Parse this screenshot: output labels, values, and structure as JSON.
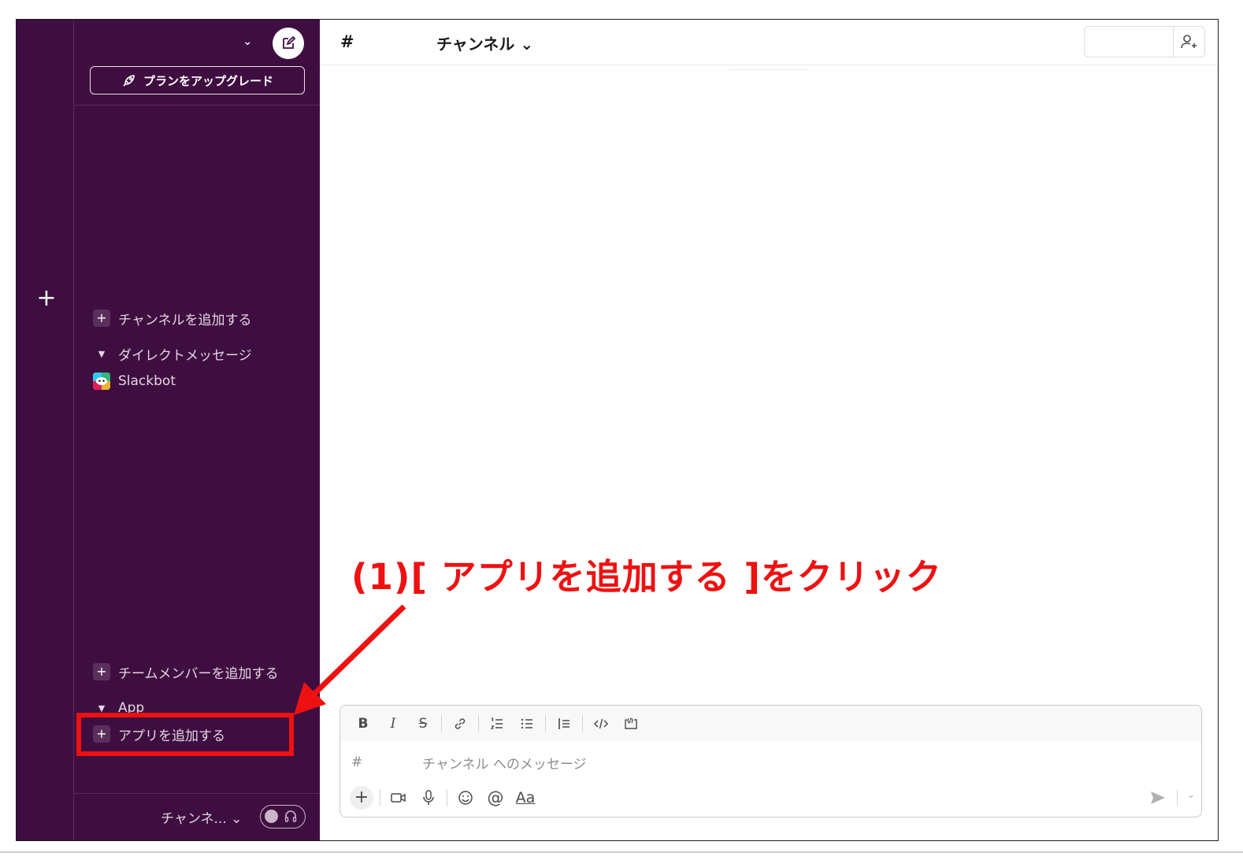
{
  "sidebar": {
    "upgrade_label": "プランをアップグレード",
    "add_channel_label": "チャンネルを追加する",
    "dm_section_label": "ダイレクトメッセージ",
    "dm_items": [
      "Slackbot"
    ],
    "add_team_member_label": "チームメンバーを追加する",
    "app_section_label": "App",
    "add_app_label": "アプリを追加する",
    "footer_channel_label": "チャンネ... ⌄"
  },
  "header": {
    "hash": "#",
    "channel_title": "チャンネル ⌄"
  },
  "composer": {
    "toolbar": [
      "B",
      "I",
      "S",
      "link",
      "ordered-list",
      "bullet-list",
      "blockquote",
      "code",
      "code-block"
    ],
    "hash": "#",
    "placeholder": "チャンネル へのメッセージ",
    "format_label": "Aa"
  },
  "annotation": {
    "text": "(1)[ アプリを追加する ]をクリック",
    "color": "#ee1111"
  },
  "colors": {
    "sidebar_bg": "#3f0e40",
    "annotation_red": "#ee1111"
  }
}
